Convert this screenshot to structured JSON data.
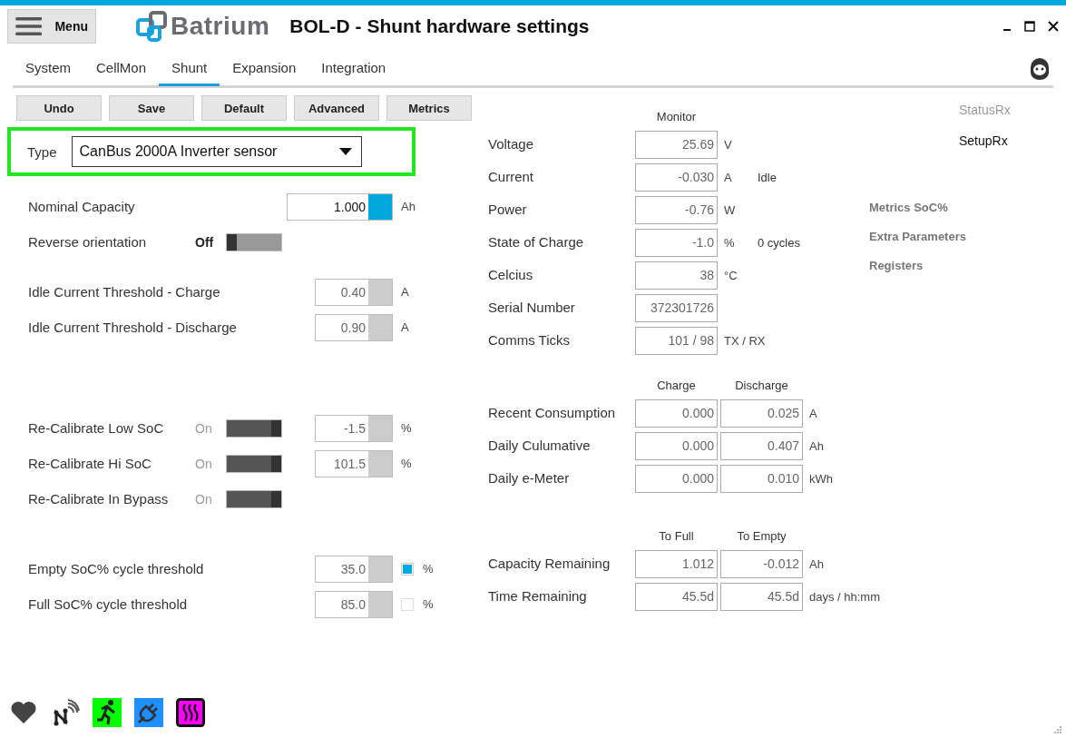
{
  "header": {
    "menu_label": "Menu",
    "logo_text": "Batrium",
    "title": "BOL-D - Shunt hardware settings"
  },
  "tabs": [
    {
      "label": "System",
      "selected": false
    },
    {
      "label": "CellMon",
      "selected": false
    },
    {
      "label": "Shunt",
      "selected": true
    },
    {
      "label": "Expansion",
      "selected": false
    },
    {
      "label": "Integration",
      "selected": false
    }
  ],
  "toolbar": [
    "Undo",
    "Save",
    "Default",
    "Advanced",
    "Metrics"
  ],
  "type_field": {
    "label": "Type",
    "value": "CanBus 2000A Inverter sensor"
  },
  "settings_groups": [
    [
      {
        "kind": "number",
        "label": "Nominal Capacity",
        "value": "1.000",
        "unit": "Ah",
        "focused": true
      },
      {
        "kind": "toggle",
        "label": "Reverse orientation",
        "state_label": "Off",
        "on": false
      }
    ],
    [
      {
        "kind": "number",
        "label": "Idle Current Threshold - Charge",
        "value": "0.40",
        "unit": "A",
        "focused": false
      },
      {
        "kind": "number",
        "label": "Idle Current Threshold - Discharge",
        "value": "0.90",
        "unit": "A",
        "focused": false
      }
    ],
    [
      {
        "kind": "toggle_number",
        "label": "Re-Calibrate Low SoC",
        "state_label": "On",
        "on": true,
        "value": "-1.5",
        "unit": "%",
        "focused": false
      },
      {
        "kind": "toggle_number",
        "label": "Re-Calibrate Hi SoC",
        "state_label": "On",
        "on": true,
        "value": "101.5",
        "unit": "%",
        "focused": false
      },
      {
        "kind": "toggle",
        "label": "Re-Calibrate In Bypass",
        "state_label": "On",
        "on": true
      }
    ],
    [
      {
        "kind": "check_number",
        "label": "Empty SoC% cycle threshold",
        "value": "35.0",
        "checked": true,
        "unit": "%",
        "focused": false
      },
      {
        "kind": "check_number",
        "label": "Full SoC% cycle threshold",
        "value": "85.0",
        "checked": false,
        "unit": "%",
        "focused": false
      }
    ]
  ],
  "monitor": {
    "heading": "Monitor",
    "rows": [
      {
        "label": "Voltage",
        "value": "25.69",
        "unit": "V"
      },
      {
        "label": "Current",
        "value": "-0.030",
        "unit": "A",
        "note": "Idle"
      },
      {
        "label": "Power",
        "value": "-0.76",
        "unit": "W"
      },
      {
        "label": "State of Charge",
        "value": "-1.0",
        "unit": "%",
        "note": "0 cycles"
      },
      {
        "label": "Celcius",
        "value": "38",
        "unit": "°C"
      },
      {
        "label": "Serial Number",
        "value": "372301726"
      },
      {
        "label": "Comms Ticks",
        "value": "101 / 98",
        "unit": "TX / RX"
      }
    ]
  },
  "consumption": {
    "columns": [
      "Charge",
      "Discharge"
    ],
    "rows": [
      {
        "label": "Recent Consumption",
        "values": [
          "0.000",
          "0.025"
        ],
        "unit": "A"
      },
      {
        "label": "Daily Culumative",
        "values": [
          "0.000",
          "0.407"
        ],
        "unit": "Ah"
      },
      {
        "label": "Daily e-Meter",
        "values": [
          "0.000",
          "0.010"
        ],
        "unit": "kWh"
      }
    ]
  },
  "remaining": {
    "columns": [
      "To Full",
      "To Empty"
    ],
    "rows": [
      {
        "label": "Capacity Remaining",
        "values": [
          "1.012",
          "-0.012"
        ],
        "unit": "Ah"
      },
      {
        "label": "Time Remaining",
        "values": [
          "45.5d",
          "45.5d"
        ],
        "unit": "days / hh:mm"
      }
    ]
  },
  "side_links": [
    "Metrics SoC%",
    "Extra Parameters",
    "Registers"
  ],
  "rx_links": [
    {
      "label": "StatusRx",
      "disabled": true
    },
    {
      "label": "SetupRx",
      "disabled": false
    }
  ],
  "status_icons": [
    {
      "kind": "heart"
    },
    {
      "kind": "network"
    },
    {
      "kind": "running",
      "color": "#00ff00"
    },
    {
      "kind": "plug",
      "color": "#1e90ff"
    },
    {
      "kind": "heater",
      "color": "#ff00ff"
    }
  ]
}
